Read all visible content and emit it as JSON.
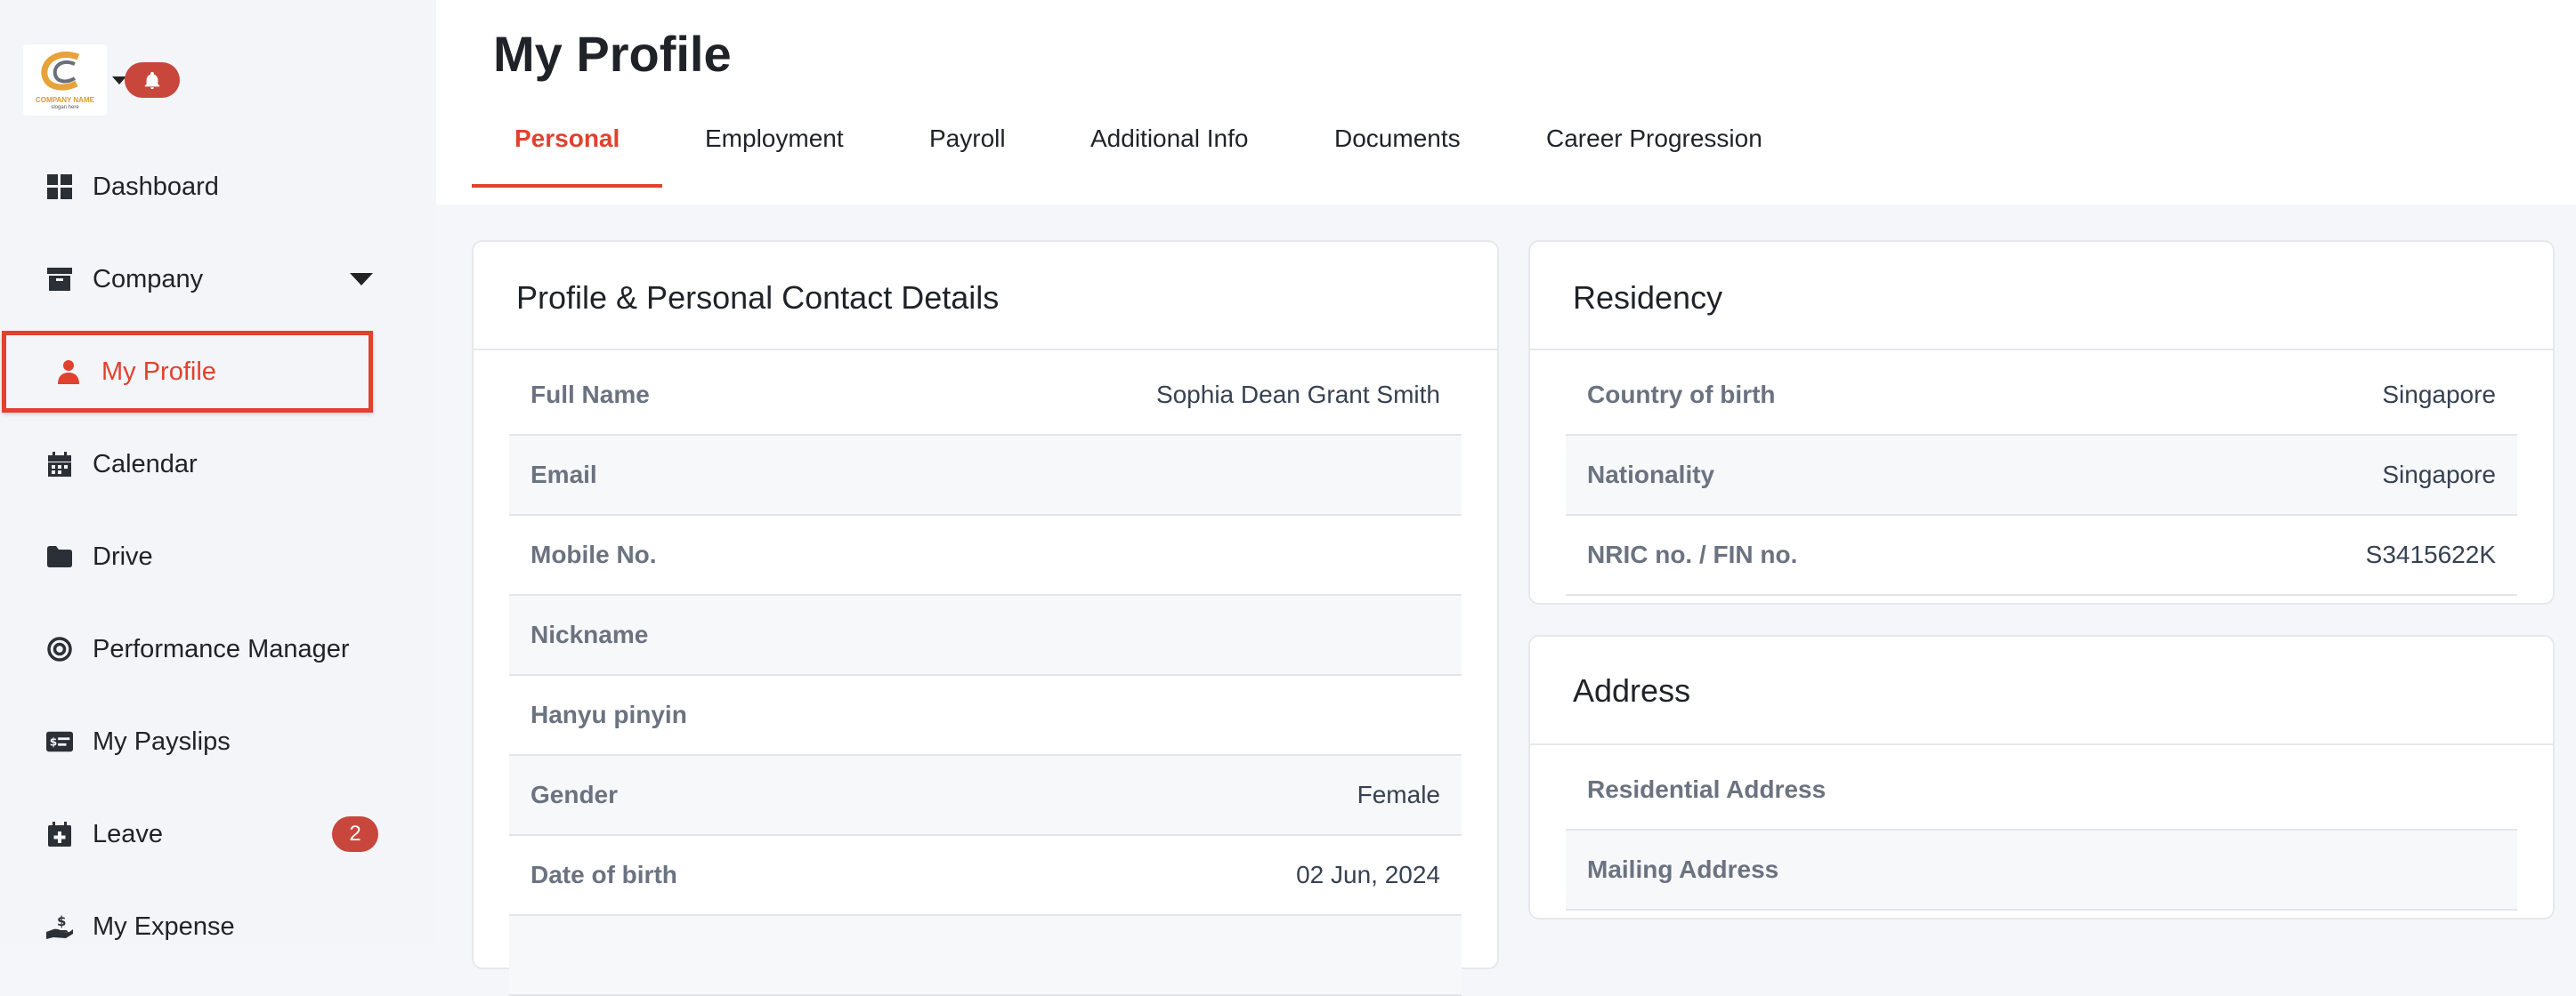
{
  "sidebar": {
    "logo": {
      "company_name": "COMPANY NAME",
      "slogan": "slogan here"
    },
    "items": [
      {
        "label": "Dashboard",
        "icon": "dashboard-icon"
      },
      {
        "label": "Company",
        "icon": "archive-box-icon"
      },
      {
        "label": "My Profile",
        "icon": "user-icon"
      },
      {
        "label": "Calendar",
        "icon": "calendar-icon"
      },
      {
        "label": "Drive",
        "icon": "folder-icon"
      },
      {
        "label": "Performance Manager",
        "icon": "target-icon"
      },
      {
        "label": "My Payslips",
        "icon": "payslip-icon"
      },
      {
        "label": "Leave",
        "icon": "calendar-plus-icon",
        "badge": "2"
      },
      {
        "label": "My Expense",
        "icon": "hand-dollar-icon"
      }
    ]
  },
  "header": {
    "title": "My Profile",
    "tabs": [
      {
        "label": "Personal"
      },
      {
        "label": "Employment"
      },
      {
        "label": "Payroll"
      },
      {
        "label": "Additional Info"
      },
      {
        "label": "Documents"
      },
      {
        "label": "Career Progression"
      }
    ]
  },
  "profile_card": {
    "title": "Profile & Personal Contact Details",
    "rows": [
      {
        "label": "Full Name",
        "value": "Sophia Dean Grant Smith"
      },
      {
        "label": "Email",
        "value": ""
      },
      {
        "label": "Mobile No.",
        "value": ""
      },
      {
        "label": "Nickname",
        "value": ""
      },
      {
        "label": "Hanyu pinyin",
        "value": ""
      },
      {
        "label": "Gender",
        "value": "Female"
      },
      {
        "label": "Date of birth",
        "value": "02 Jun, 2024"
      }
    ]
  },
  "residency_card": {
    "title": "Residency",
    "rows": [
      {
        "label": "Country of birth",
        "value": "Singapore"
      },
      {
        "label": "Nationality",
        "value": "Singapore"
      },
      {
        "label": "NRIC no. / FIN no.",
        "value": "S3415622K"
      }
    ]
  },
  "address_card": {
    "title": "Address",
    "rows": [
      {
        "label": "Residential Address",
        "value": ""
      },
      {
        "label": "Mailing Address",
        "value": ""
      }
    ]
  },
  "colors": {
    "accent": "#e1412f",
    "badge": "#c8463b",
    "sidebar_bg": "#f4f5f9"
  }
}
